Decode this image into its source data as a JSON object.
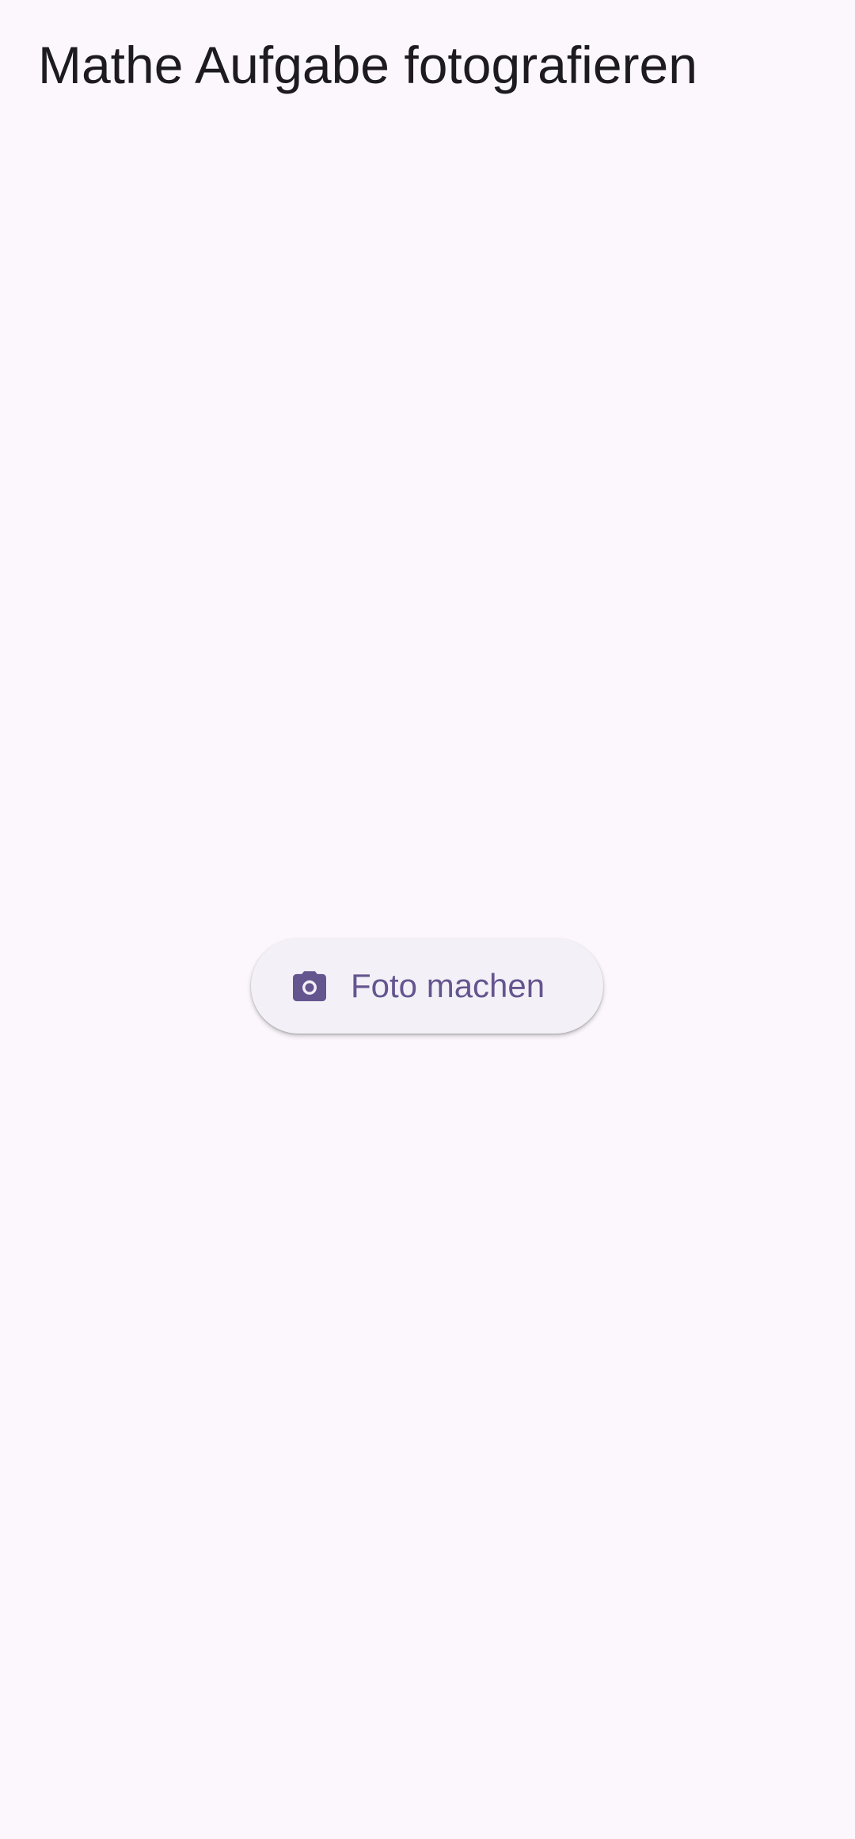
{
  "app_bar": {
    "title": "Mathe Aufgabe fotografieren"
  },
  "main": {
    "photo_button": {
      "label": "Foto machen",
      "icon": "camera-icon"
    }
  },
  "colors": {
    "background": "#FCF7FC",
    "title_text": "#1D1B20",
    "button_background": "#F3F1F7",
    "accent": "#65558F"
  }
}
